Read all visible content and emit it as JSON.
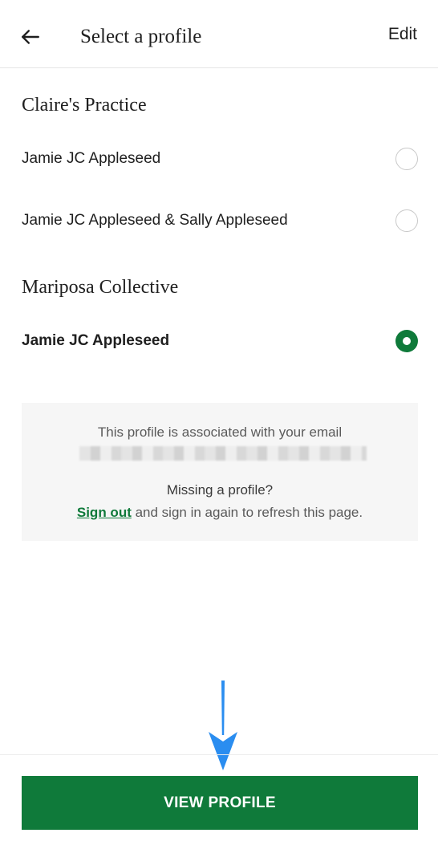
{
  "header": {
    "title": "Select a profile",
    "edit_label": "Edit",
    "back_icon": "arrow-left-icon"
  },
  "sections": [
    {
      "title": "Claire's Practice",
      "profiles": [
        {
          "name": "Jamie JC Appleseed",
          "selected": false
        },
        {
          "name": "Jamie JC Appleseed & Sally Appleseed",
          "selected": false
        }
      ]
    },
    {
      "title": "Mariposa Collective",
      "profiles": [
        {
          "name": "Jamie JC Appleseed",
          "selected": true
        }
      ]
    }
  ],
  "info": {
    "associated_text": "This profile is associated with your email",
    "missing_text": "Missing a profile?",
    "sign_out_label": "Sign out",
    "refresh_text": " and sign in again to refresh this page."
  },
  "footer": {
    "button_label": "VIEW PROFILE"
  },
  "colors": {
    "accent": "#0f7a3a",
    "annotation_arrow": "#2a8df0"
  }
}
